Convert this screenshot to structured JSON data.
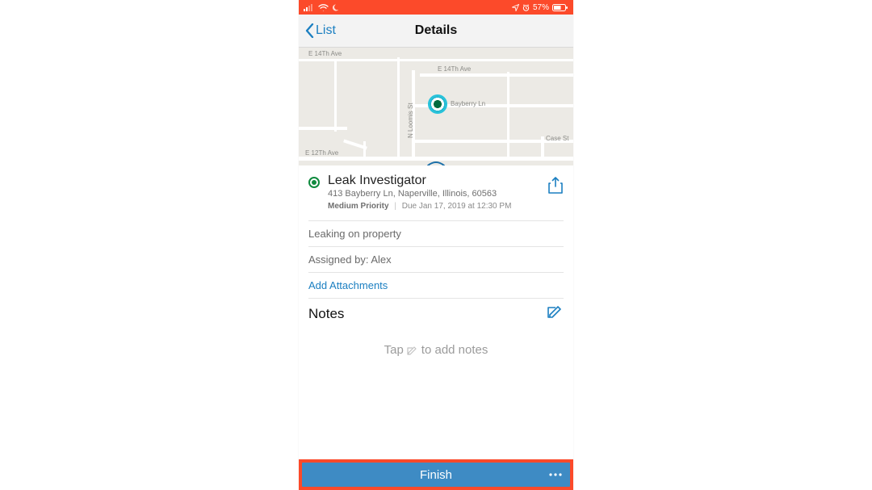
{
  "status_bar": {
    "battery_text": "57%"
  },
  "nav": {
    "back_label": "List",
    "title": "Details"
  },
  "map": {
    "streets": {
      "top1": "E 14Th Ave",
      "top2": "E 14Th Ave",
      "right_mid": "Bayberry Ln",
      "bottom": "E 12Th Ave",
      "right_edge": "Case St",
      "vertical": "N Loomis St"
    }
  },
  "task": {
    "title": "Leak Investigator",
    "address": "413 Bayberry Ln, Naperville, Illinois, 60563",
    "priority": "Medium Priority",
    "due": "Due Jan 17, 2019 at 12:30 PM"
  },
  "rows": {
    "description": "Leaking on property",
    "assigned": "Assigned by: Alex",
    "add_attachments": "Add Attachments"
  },
  "notes": {
    "header": "Notes",
    "placeholder_pre": "Tap",
    "placeholder_post": "to add notes"
  },
  "finish": {
    "label": "Finish"
  }
}
